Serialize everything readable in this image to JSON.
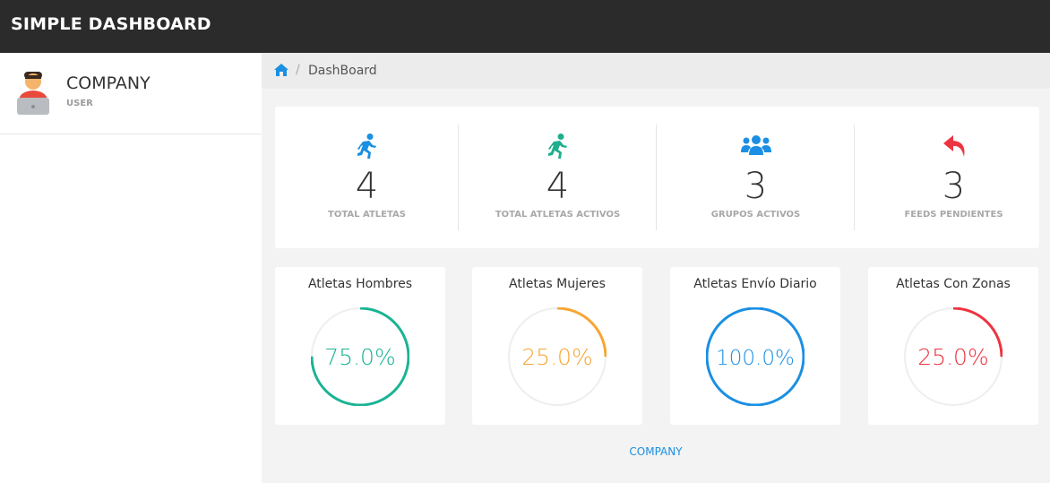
{
  "header": {
    "title": "SIMPLE DASHBOARD"
  },
  "sidebar": {
    "profile": {
      "name": "COMPANY",
      "role": "USER",
      "icon": "user-avatar-icon"
    }
  },
  "breadcrumb": {
    "home_icon": "home-icon",
    "separator": "/",
    "current": "DashBoard"
  },
  "stats": [
    {
      "icon": "running-person-icon",
      "color": "#1a8fe3",
      "value": "4",
      "label": "TOTAL ATLETAS"
    },
    {
      "icon": "running-person-icon",
      "color": "#1fae8e",
      "value": "4",
      "label": "TOTAL ATLETAS ACTIVOS"
    },
    {
      "icon": "users-group-icon",
      "color": "#1a8fe3",
      "value": "3",
      "label": "GRUPOS ACTIVOS"
    },
    {
      "icon": "reply-arrow-icon",
      "color": "#ee3340",
      "value": "3",
      "label": "FEEDS PENDIENTES"
    }
  ],
  "cards": [
    {
      "title": "Atletas Hombres",
      "percent": 75,
      "percent_label": "75.0%",
      "color": "#1ab394"
    },
    {
      "title": "Atletas Mujeres",
      "percent": 25,
      "percent_label": "25.0%",
      "color": "#f8a532"
    },
    {
      "title": "Atletas Envío Diario",
      "percent": 100,
      "percent_label": "100.0%",
      "color": "#1a8fe3"
    },
    {
      "title": "Atletas Con Zonas",
      "percent": 25,
      "percent_label": "25.0%",
      "color": "#ee3340"
    }
  ],
  "footer": {
    "text": "COMPANY"
  }
}
